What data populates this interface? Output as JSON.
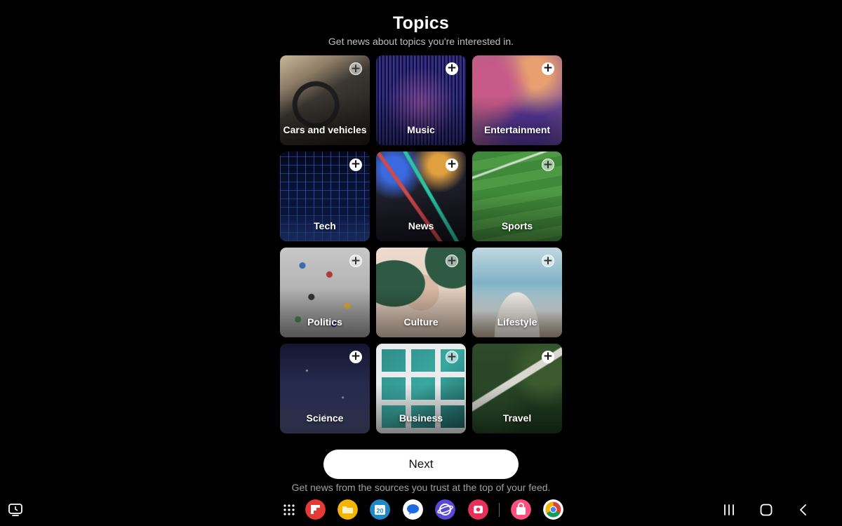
{
  "header": {
    "title": "Topics",
    "subtitle": "Get news about topics you're interested in."
  },
  "topics": [
    {
      "label": "Cars and vehicles",
      "image": "car-interior-steering-wheel"
    },
    {
      "label": "Music",
      "image": "purple-sound-wave"
    },
    {
      "label": "Entertainment",
      "image": "blurred-bokeh-lights"
    },
    {
      "label": "Tech",
      "image": "blue-wireframe-grid"
    },
    {
      "label": "News",
      "image": "colorful-stock-chart"
    },
    {
      "label": "Sports",
      "image": "green-soccer-field"
    },
    {
      "label": "Politics",
      "image": "crowd-aerial-view"
    },
    {
      "label": "Culture",
      "image": "abstract-leaf-art"
    },
    {
      "label": "Lifestyle",
      "image": "child-running-in-sea"
    },
    {
      "label": "Science",
      "image": "starry-night-sky"
    },
    {
      "label": "Business",
      "image": "glass-office-building"
    },
    {
      "label": "Travel",
      "image": "road-through-forest"
    }
  ],
  "add_icon": "+",
  "next_label": "Next",
  "footnote": "Get news from the sources you trust at the top of your feed.",
  "dock": {
    "calendar_day": "20",
    "apps": [
      "app-drawer-icon",
      "flipboard-app-icon",
      "my-files-app-icon",
      "calendar-app-icon",
      "messages-app-icon",
      "internet-browser-app-icon",
      "screen-recorder-app-icon",
      "galaxy-store-app-icon",
      "chrome-app-icon"
    ]
  },
  "colors": {
    "background": "#000000",
    "button_bg": "#ffffff",
    "button_text": "#111111"
  }
}
